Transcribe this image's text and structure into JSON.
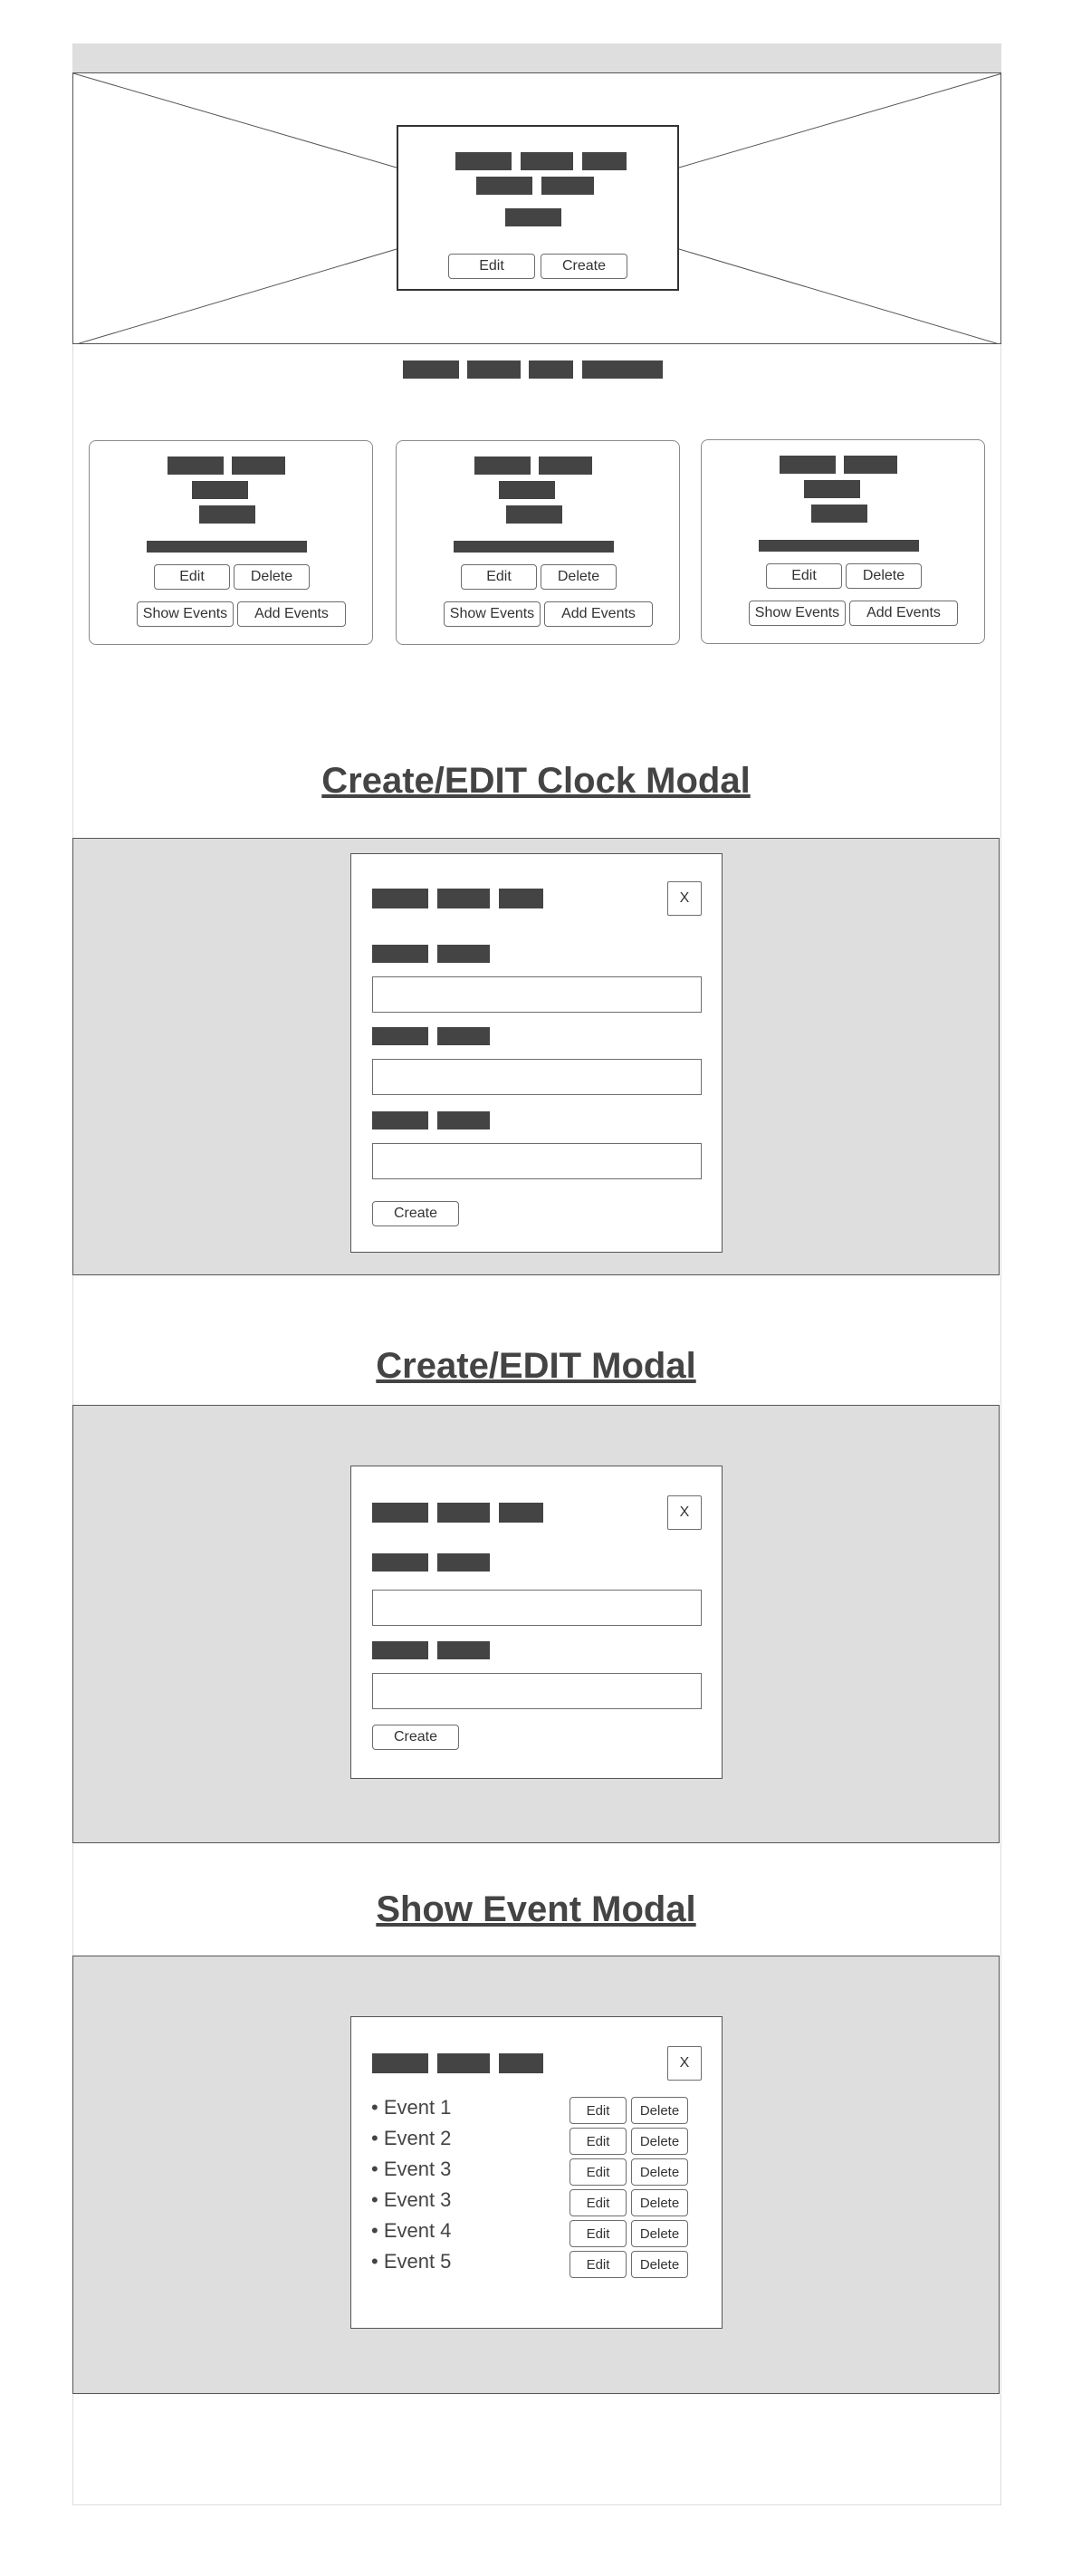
{
  "hero": {
    "card": {
      "edit_label": "Edit",
      "create_label": "Create"
    }
  },
  "clock_cards": [
    {
      "edit_label": "Edit",
      "delete_label": "Delete",
      "show_events_label": "Show Events",
      "add_events_label": "Add Events"
    },
    {
      "edit_label": "Edit",
      "delete_label": "Delete",
      "show_events_label": "Show Events",
      "add_events_label": "Add Events"
    },
    {
      "edit_label": "Edit",
      "delete_label": "Delete",
      "show_events_label": "Show Events",
      "add_events_label": "Add Events"
    }
  ],
  "clock_modal": {
    "title": "Create/EDIT Clock Modal",
    "close_label": "X",
    "submit_label": "Create"
  },
  "edit_modal": {
    "title": "Create/EDIT Modal",
    "close_label": "X",
    "submit_label": "Create"
  },
  "event_modal": {
    "title": "Show Event Modal",
    "close_label": "X",
    "events": [
      {
        "label": "• Event 1",
        "edit_label": "Edit",
        "delete_label": "Delete"
      },
      {
        "label": "• Event 2",
        "edit_label": "Edit",
        "delete_label": "Delete"
      },
      {
        "label": "• Event 3",
        "edit_label": "Edit",
        "delete_label": "Delete"
      },
      {
        "label": "• Event 3",
        "edit_label": "Edit",
        "delete_label": "Delete"
      },
      {
        "label": "• Event 4",
        "edit_label": "Edit",
        "delete_label": "Delete"
      },
      {
        "label": "• Event 5",
        "edit_label": "Edit",
        "delete_label": "Delete"
      }
    ]
  },
  "colors": {
    "placeholder_block": "#444444",
    "overlay_background": "#dedede",
    "border": "#555555"
  }
}
